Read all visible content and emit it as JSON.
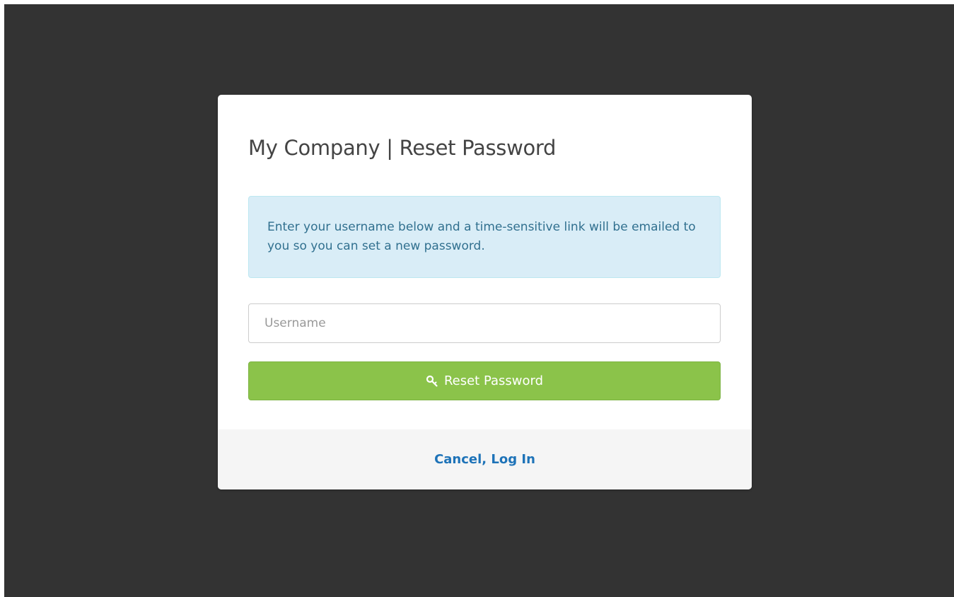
{
  "modal": {
    "title": "My Company | Reset Password",
    "info_text": "Enter your username below and a time-sensitive link will be emailed to you so you can set a new password.",
    "username_input": {
      "value": "",
      "placeholder": "Username"
    },
    "reset_button": {
      "icon": "key-icon",
      "label": "Reset Password"
    },
    "footer": {
      "cancel_link": "Cancel, Log In"
    }
  },
  "colors": {
    "backdrop": "#333333",
    "info_bg": "#d9edf7",
    "info_text": "#31708f",
    "button_green": "#8bc34a",
    "link_blue": "#1e73b8",
    "footer_bg": "#f5f5f5"
  }
}
